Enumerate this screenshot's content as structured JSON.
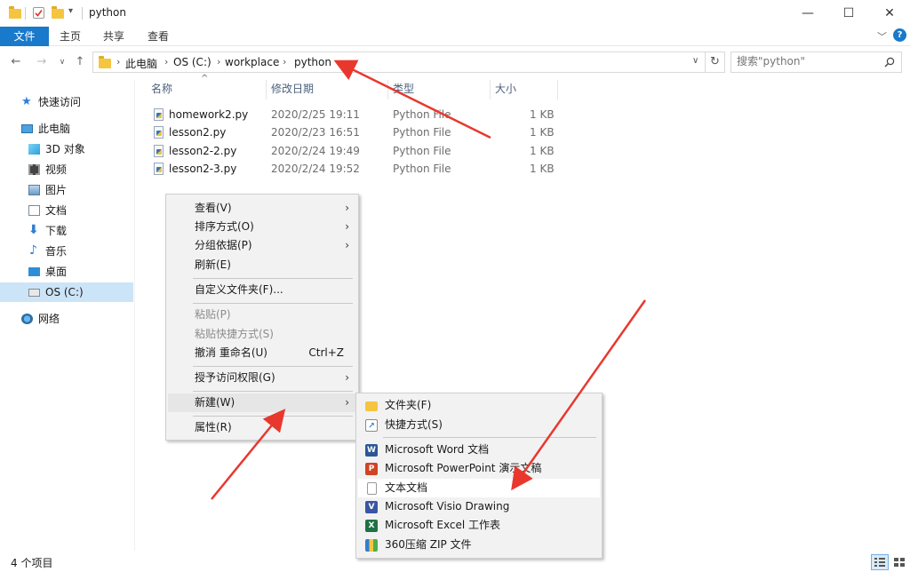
{
  "window": {
    "title": "python",
    "minimize": "—",
    "maximize": "☐",
    "close": "✕"
  },
  "ribbon": {
    "tabs": [
      "文件",
      "主页",
      "共享",
      "查看"
    ],
    "expand": "﹀",
    "help": "?"
  },
  "address": {
    "crumbs": [
      "此电脑",
      "OS (C:)",
      "workplace",
      "python"
    ],
    "dropdown": "∨",
    "refresh": "↻"
  },
  "search": {
    "placeholder": "搜索\"python\"",
    "icon": "search-icon"
  },
  "nav": {
    "items": [
      {
        "label": "快速访问",
        "icon": "star-icon"
      },
      {
        "label": "此电脑",
        "icon": "computer-icon"
      },
      {
        "label": "3D 对象",
        "icon": "cube-icon"
      },
      {
        "label": "视频",
        "icon": "video-icon"
      },
      {
        "label": "图片",
        "icon": "picture-icon"
      },
      {
        "label": "文档",
        "icon": "document-icon"
      },
      {
        "label": "下载",
        "icon": "download-icon"
      },
      {
        "label": "音乐",
        "icon": "music-icon"
      },
      {
        "label": "桌面",
        "icon": "desktop-icon"
      },
      {
        "label": "OS (C:)",
        "icon": "drive-icon"
      },
      {
        "label": "网络",
        "icon": "network-icon"
      }
    ]
  },
  "list": {
    "headers": {
      "name": "名称",
      "date": "修改日期",
      "type": "类型",
      "size": "大小"
    },
    "sort_indicator": "^",
    "files": [
      {
        "name": "homework2.py",
        "date": "2020/2/25 19:11",
        "type": "Python File",
        "size": "1 KB"
      },
      {
        "name": "lesson2.py",
        "date": "2020/2/23 16:51",
        "type": "Python File",
        "size": "1 KB"
      },
      {
        "name": "lesson2-2.py",
        "date": "2020/2/24 19:49",
        "type": "Python File",
        "size": "1 KB"
      },
      {
        "name": "lesson2-3.py",
        "date": "2020/2/24 19:52",
        "type": "Python File",
        "size": "1 KB"
      }
    ]
  },
  "context_menu": {
    "items": [
      {
        "label": "查看(V)",
        "arrow": "›"
      },
      {
        "label": "排序方式(O)",
        "arrow": "›"
      },
      {
        "label": "分组依据(P)",
        "arrow": "›"
      },
      {
        "label": "刷新(E)"
      },
      {
        "label": "自定义文件夹(F)..."
      },
      {
        "label": "粘贴(P)"
      },
      {
        "label": "粘贴快捷方式(S)"
      },
      {
        "label": "撤消 重命名(U)",
        "shortcut": "Ctrl+Z"
      },
      {
        "label": "授予访问权限(G)",
        "arrow": "›"
      },
      {
        "label": "新建(W)",
        "arrow": "›"
      },
      {
        "label": "属性(R)"
      }
    ]
  },
  "new_submenu": {
    "items": [
      {
        "label": "文件夹(F)",
        "icon": "folder-icon"
      },
      {
        "label": "快捷方式(S)",
        "icon": "shortcut-icon"
      },
      {
        "label": "Microsoft Word 文档",
        "icon": "word-icon"
      },
      {
        "label": "Microsoft PowerPoint 演示文稿",
        "icon": "powerpoint-icon"
      },
      {
        "label": "文本文档",
        "icon": "text-document-icon"
      },
      {
        "label": "Microsoft Visio Drawing",
        "icon": "visio-icon"
      },
      {
        "label": "Microsoft Excel 工作表",
        "icon": "excel-icon"
      },
      {
        "label": "360压缩 ZIP 文件",
        "icon": "zip-icon"
      }
    ]
  },
  "status": {
    "item_count": "4 个项目"
  },
  "colors": {
    "file_tab": "#1979ca",
    "selection": "#cce4f7",
    "annotation_arrow": "#e8382e",
    "header_text": "#4c607a"
  }
}
